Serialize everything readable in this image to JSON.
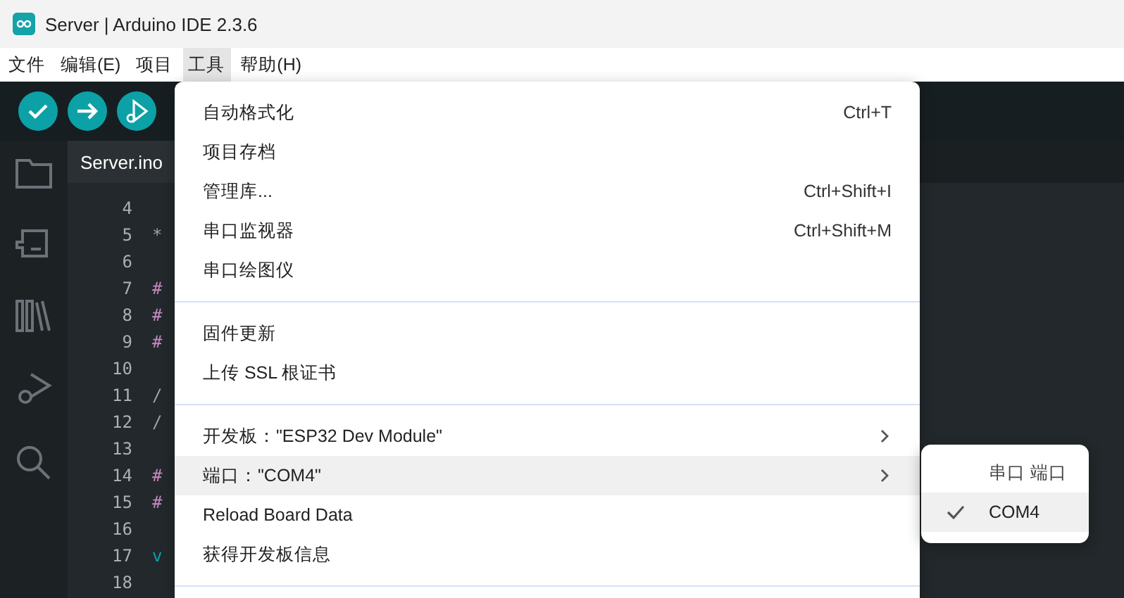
{
  "window": {
    "title": "Server | Arduino IDE 2.3.6"
  },
  "menubar": [
    {
      "label": "文件",
      "selected": false
    },
    {
      "label": "编辑(E)",
      "selected": false
    },
    {
      "label": "项目",
      "selected": false
    },
    {
      "label": "工具",
      "selected": true
    },
    {
      "label": "帮助(H)",
      "selected": false
    }
  ],
  "editor": {
    "tab": "Server.ino",
    "lines": [
      {
        "number": "4"
      },
      {
        "number": "5",
        "code": "*",
        "kind": "comment"
      },
      {
        "number": "6"
      },
      {
        "number": "7",
        "code": "#",
        "kind": "directive"
      },
      {
        "number": "8",
        "code": "#",
        "kind": "directive"
      },
      {
        "number": "9",
        "code": "#",
        "kind": "directive"
      },
      {
        "number": "10"
      },
      {
        "number": "11",
        "code": "/",
        "kind": "comment"
      },
      {
        "number": "12",
        "code": "/",
        "kind": "comment"
      },
      {
        "number": "13"
      },
      {
        "number": "14",
        "code": "#",
        "kind": "directive"
      },
      {
        "number": "15",
        "code": "#",
        "kind": "directive"
      },
      {
        "number": "16"
      },
      {
        "number": "17",
        "code": "v",
        "kind": "keyword"
      },
      {
        "number": "18"
      }
    ]
  },
  "menu": {
    "sections": [
      [
        {
          "label": "自动格式化",
          "shortcut": "Ctrl+T",
          "submenu": false,
          "selected": false
        },
        {
          "label": "项目存档",
          "submenu": false,
          "selected": false
        },
        {
          "label": "管理库...",
          "shortcut": "Ctrl+Shift+I",
          "submenu": false,
          "selected": false
        },
        {
          "label": "串口监视器",
          "shortcut": "Ctrl+Shift+M",
          "submenu": false,
          "selected": false
        },
        {
          "label": "串口绘图仪",
          "submenu": false,
          "selected": false
        }
      ],
      [
        {
          "label": "固件更新",
          "submenu": false,
          "selected": false
        },
        {
          "label": "上传 SSL 根证书",
          "submenu": false,
          "selected": false
        }
      ],
      [
        {
          "label": "开发板：\"ESP32 Dev Module\"",
          "submenu": true,
          "selected": false
        },
        {
          "label": "端口：\"COM4\"",
          "submenu": true,
          "selected": true
        },
        {
          "label": "Reload Board Data",
          "submenu": false,
          "selected": false
        },
        {
          "label": "获得开发板信息",
          "submenu": false,
          "selected": false
        }
      ]
    ]
  },
  "submenu": {
    "items": [
      {
        "kind": "header",
        "label": "串口 端口"
      },
      {
        "kind": "option",
        "label": "COM4",
        "checked": true,
        "selected": true
      }
    ]
  }
}
